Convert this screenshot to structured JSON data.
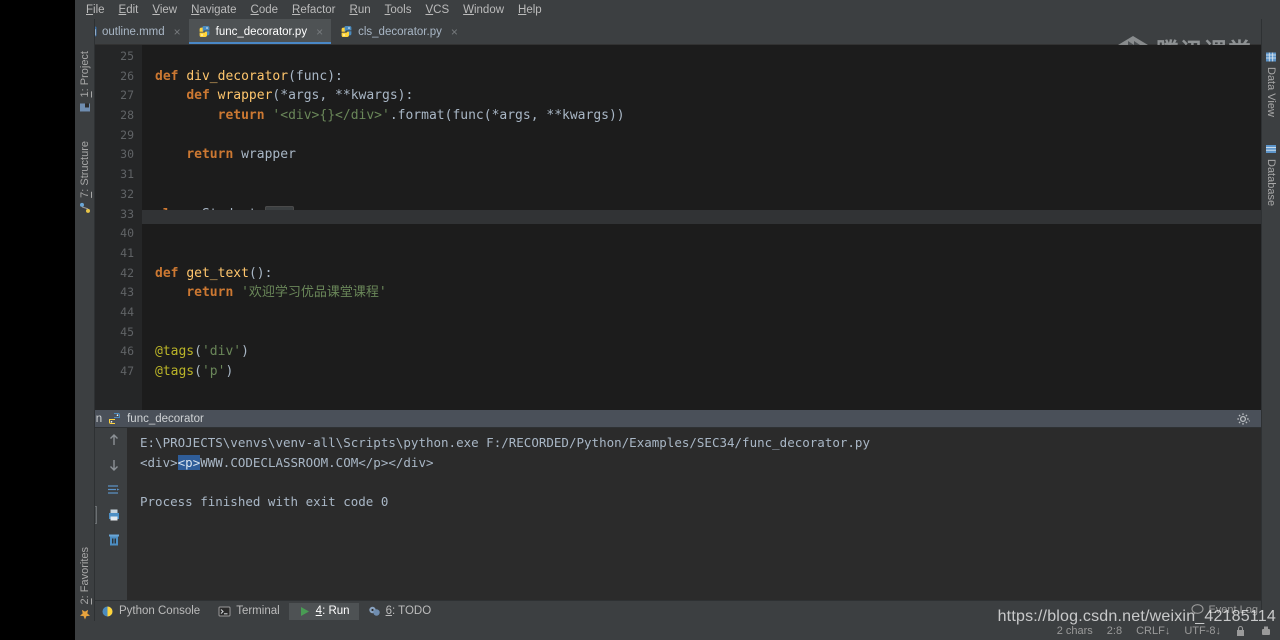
{
  "menu": {
    "items": [
      "File",
      "Edit",
      "View",
      "Navigate",
      "Code",
      "Refactor",
      "Run",
      "Tools",
      "VCS",
      "Window",
      "Help"
    ]
  },
  "tabs": [
    {
      "label": "outline.mmd",
      "icon": "mmd-file-icon",
      "active": false,
      "close": "×"
    },
    {
      "label": "func_decorator.py",
      "icon": "python-file-icon",
      "active": true,
      "close": "×"
    },
    {
      "label": "cls_decorator.py",
      "icon": "python-file-icon",
      "active": false,
      "close": "×"
    }
  ],
  "logo": {
    "text": "腾讯课堂",
    "icon": "tencent-classroom-logo"
  },
  "editor": {
    "file": "func_decorator.py",
    "lines": [
      {
        "num": "25",
        "fold": "",
        "html": ""
      },
      {
        "num": "26",
        "fold": "minus",
        "html": "<span class=\"kw\">def </span><span class=\"fn\">div_decorator</span><span class=\"punct\">(func):</span>"
      },
      {
        "num": "27",
        "fold": "minus",
        "html": "    <span class=\"kw\">def </span><span class=\"fn\">wrapper</span><span class=\"punct\">(*args, **kwargs):</span>"
      },
      {
        "num": "28",
        "fold": "end",
        "html": "        <span class=\"kw\">return </span><span class=\"str\">'&lt;div&gt;{}&lt;/div&gt;'</span><span class=\"punct\">.format(func(*args, **kwargs))</span>"
      },
      {
        "num": "29",
        "fold": "",
        "html": ""
      },
      {
        "num": "30",
        "fold": "end",
        "html": "    <span class=\"kw\">return </span><span class=\"param\">wrapper</span>"
      },
      {
        "num": "31",
        "fold": "",
        "html": ""
      },
      {
        "num": "32",
        "fold": "",
        "html": ""
      },
      {
        "num": "33",
        "fold": "plus",
        "html": "<span class=\"kw\">class </span><span class=\"cls\">Student:</span><span class=\"folded\">...</span>"
      },
      {
        "num": "40",
        "fold": "",
        "html": ""
      },
      {
        "num": "41",
        "fold": "",
        "html": ""
      },
      {
        "num": "42",
        "fold": "minus",
        "html": "<span class=\"kw\">def </span><span class=\"fn\">get_text</span><span class=\"punct\">():</span>"
      },
      {
        "num": "43",
        "fold": "end",
        "html": "    <span class=\"kw\">return </span><span class=\"str\">'欢迎学习优品课堂课程'</span>"
      },
      {
        "num": "44",
        "fold": "",
        "html": ""
      },
      {
        "num": "45",
        "fold": "",
        "html": ""
      },
      {
        "num": "46",
        "fold": "",
        "html": "<span class=\"deco\">@tags</span><span class=\"punct\">(</span><span class=\"decostr\">'div'</span><span class=\"punct\">)</span>"
      },
      {
        "num": "47",
        "fold": "",
        "html": "<span class=\"deco\">@tags</span><span class=\"punct\">(</span><span class=\"decostr\">'p'</span><span class=\"punct\">)</span>"
      }
    ]
  },
  "run_panel": {
    "title": "Run",
    "config_name": "func_decorator",
    "config_icon": "python-run-config-icon",
    "settings_icon": "gear-icon",
    "hide_icon": "hide-panel-icon",
    "toolbar_left": [
      "run-icon",
      "stop-icon",
      "pause-icon",
      "rerun-icon",
      "pin-icon",
      "close-icon",
      "expand-icon"
    ],
    "toolbar_right": [
      "scroll-up-icon",
      "scroll-down-icon",
      "soft-wrap-icon",
      "print-icon",
      "clear-all-icon"
    ],
    "console": {
      "command": "E:\\PROJECTS\\venvs\\venv-all\\Scripts\\python.exe F:/RECORDED/Python/Examples/SEC34/func_decorator.py",
      "output_before": "<div>",
      "output_selected": "<p>",
      "output_after": "WWW.CODECLASSROOM.COM</p></div>",
      "exit_line": "Process finished with exit code 0"
    }
  },
  "bottom_bar": {
    "items": [
      {
        "label": "Python Console",
        "mnemonic": "",
        "icon": "python-console-icon",
        "active": false
      },
      {
        "label": "Terminal",
        "mnemonic": "",
        "icon": "terminal-icon",
        "active": false
      },
      {
        "label": ": Run",
        "mnemonic": "4",
        "icon": "run-green-icon",
        "active": true
      },
      {
        "label": ": TODO",
        "mnemonic": "6",
        "icon": "todo-icon",
        "active": false
      }
    ],
    "event_log": {
      "label": "Event Log",
      "icon": "event-log-icon"
    }
  },
  "status_bar": {
    "chars": "2 chars",
    "caret": "2:8",
    "line_separator": "CRLF↓",
    "encoding": "UTF-8↓",
    "lock_icon": "lock-icon",
    "branch_icon": "vcs-branch-icon"
  },
  "left_strip": {
    "tabs": [
      {
        "label": ": Project",
        "mnemonic": "1",
        "icon": "project-icon"
      },
      {
        "label": ": Structure",
        "mnemonic": "7",
        "icon": "structure-icon"
      },
      {
        "label": ": Favorites",
        "mnemonic": "2",
        "icon": "favorites-star-icon"
      }
    ]
  },
  "right_strip": {
    "tabs": [
      {
        "label": "Data View",
        "icon": "data-view-icon"
      },
      {
        "label": "Database",
        "icon": "database-icon"
      }
    ]
  },
  "watermark": {
    "text": "https://blog.csdn.net/weixin_42185114"
  },
  "colors": {
    "chrome": "#3c3f41",
    "editor_bg": "#1c1c1c",
    "console_bg": "#2b2b2b",
    "accent_tab": "#4a88c7",
    "keyword": "#cc7832",
    "function": "#ffc66d",
    "string": "#6a8759",
    "decorator": "#bbb529",
    "default_text": "#a9b7c6",
    "selection": "#2f5d99"
  }
}
